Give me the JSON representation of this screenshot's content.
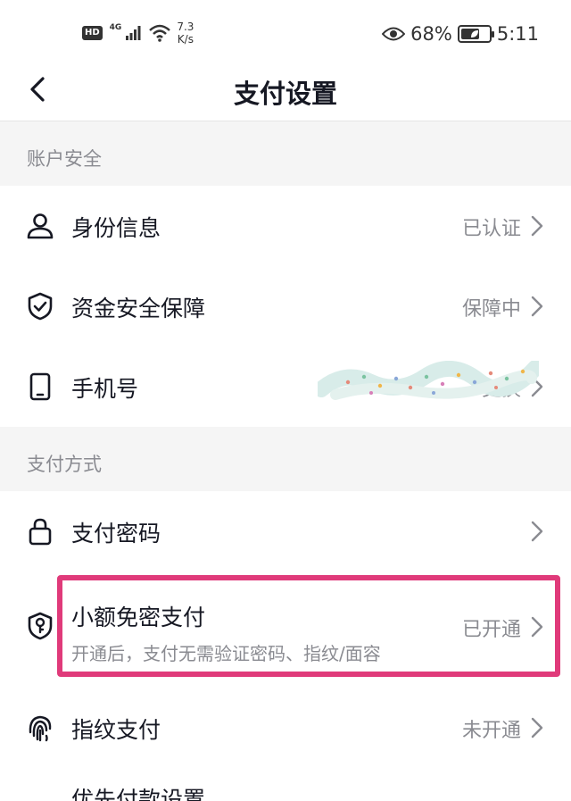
{
  "status_bar": {
    "hd": "HD",
    "network": "4G",
    "speed_value": "7.3",
    "speed_unit": "K/s",
    "battery_percent": "68%",
    "battery_level": 0.68,
    "time": "5:11"
  },
  "nav": {
    "title": "支付设置"
  },
  "sections": {
    "account_security": {
      "title": "账户安全",
      "identity": {
        "label": "身份信息",
        "value": "已认证"
      },
      "fund_security": {
        "label": "资金安全保障",
        "value": "保障中"
      },
      "phone": {
        "label": "手机号",
        "value": "更换"
      }
    },
    "payment_methods": {
      "title": "支付方式",
      "pay_password": {
        "label": "支付密码",
        "value": ""
      },
      "small_amount": {
        "label": "小额免密支付",
        "desc": "开通后，支付无需验证密码、指纹/面容",
        "value": "已开通"
      },
      "fingerprint": {
        "label": "指纹支付",
        "value": "未开通"
      },
      "partial": {
        "label": "优先付款设置"
      }
    }
  },
  "colors": {
    "highlight": "#e03a7a",
    "text_primary": "#161823",
    "text_secondary": "#8a8b91",
    "section_bg": "#f5f5f5"
  }
}
